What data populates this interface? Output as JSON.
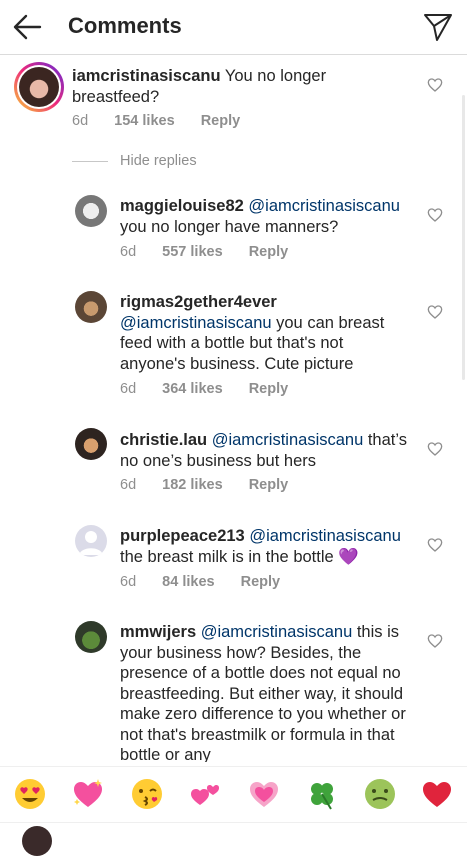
{
  "header": {
    "title": "Comments",
    "back_icon": "arrow-left-icon",
    "direct_icon": "paper-plane-icon"
  },
  "colors": {
    "text": "#262626",
    "secondary": "#8e8e8e",
    "mention": "#003569",
    "heart_red": "#ed4956",
    "purple_heart": "#9b30ff"
  },
  "main_comment": {
    "username": "iamcristinasiscanu",
    "text": " You no longer breastfeed?",
    "time": "6d",
    "likes": "154 likes",
    "reply": "Reply"
  },
  "hide_replies": "Hide replies",
  "replies": [
    {
      "username": "maggielouise82",
      "mention": "@iamcristinasiscanu",
      "text": " you no longer have manners?",
      "time": "6d",
      "likes": "557 likes",
      "reply": "Reply"
    },
    {
      "username": "rigmas2gether4ever",
      "mention": "@iamcristinasiscanu",
      "text": " you can breast feed with a bottle but that's not anyone's business. Cute picture",
      "time": "6d",
      "likes": "364 likes",
      "reply": "Reply"
    },
    {
      "username": "christie.lau",
      "mention": "@iamcristinasiscanu",
      "text": " that’s no one’s business but hers",
      "time": "6d",
      "likes": "182 likes",
      "reply": "Reply"
    },
    {
      "username": "purplepeace213",
      "mention": "@iamcristinasiscanu",
      "text": " the breast milk is in the bottle",
      "emoji": "💜",
      "time": "6d",
      "likes": "84 likes",
      "reply": "Reply"
    },
    {
      "username": "mmwijers",
      "mention": "@iamcristinasiscanu",
      "text": " this is your business how? Besides, the presence of a bottle does not equal no breastfeeding. But either way, it should make zero difference to you whether or not that's breastmilk or formula in that bottle or any"
    }
  ],
  "emoji_bar": [
    {
      "name": "heart-eyes-emoji",
      "char": "😍"
    },
    {
      "name": "sparkling-heart-emoji",
      "char": "💖"
    },
    {
      "name": "kissing-face-emoji",
      "char": "😘"
    },
    {
      "name": "two-hearts-emoji",
      "char": "💕"
    },
    {
      "name": "pink-heart-emoji",
      "char": "💗"
    },
    {
      "name": "four-leaf-clover-emoji",
      "char": "🍀"
    },
    {
      "name": "nauseated-face-emoji",
      "char": "🤢"
    },
    {
      "name": "red-heart-emoji",
      "char": "❤️"
    }
  ]
}
